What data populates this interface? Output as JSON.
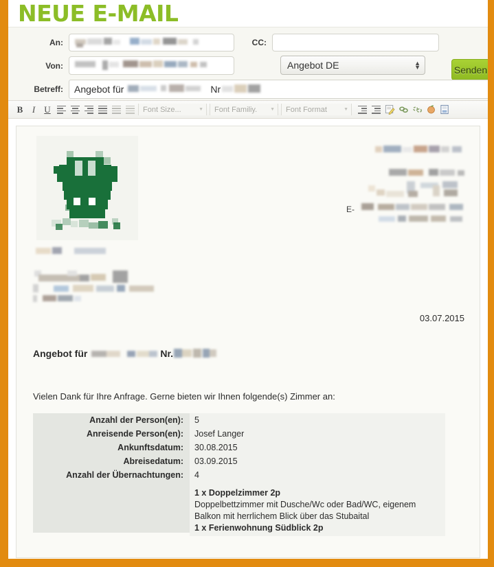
{
  "window": {
    "title": "NEUE E-MAIL",
    "title_color": "#8cbd27",
    "frame_color": "#e28b10"
  },
  "form": {
    "to_label": "An:",
    "to_value": "",
    "from_label": "Von:",
    "from_value": "",
    "cc_label": "CC:",
    "cc_value": "",
    "subject_label": "Betreff:",
    "subject_value": "Angebot für",
    "subject_value_tail": "Nr",
    "template_select": "Angebot DE",
    "send_label": "Senden"
  },
  "toolbar": {
    "bold": "B",
    "italic": "I",
    "underline": "U",
    "align_left": "align-left",
    "align_center": "align-center",
    "align_right": "align-right",
    "align_justify": "align-justify",
    "list_ordered": "ordered-list",
    "list_unordered": "unordered-list",
    "font_size": "Font Size...",
    "font_family": "Font Familiy.",
    "font_format": "Font Format",
    "indent": "indent",
    "outdent": "outdent",
    "spellcheck": "spellcheck",
    "link": "link",
    "unlink": "unlink",
    "anchor": "anchor",
    "source": "source"
  },
  "email": {
    "logo_alt": "cow-head-logo",
    "logo_color": "#19703a",
    "contact_prefix": "E-",
    "date": "03.07.2015",
    "offer_heading": "Angebot für",
    "offer_number_label": "Nr.",
    "intro": "Vielen Dank für Ihre Anfrage. Gerne bieten wir Ihnen folgende(s) Zimmer an:",
    "watermark": "",
    "details": [
      {
        "key": "Anzahl der Person(en):",
        "value": "5"
      },
      {
        "key": "Anreisende Person(en):",
        "value": "Josef Langer"
      },
      {
        "key": "Ankunftsdatum:",
        "value": "30.08.2015"
      },
      {
        "key": "Abreisedatum:",
        "value": "03.09.2015"
      },
      {
        "key": "Anzahl der Übernachtungen:",
        "value": "4"
      }
    ],
    "rooms": [
      {
        "title": "1 x Doppelzimmer 2p",
        "desc_line1": "Doppelbettzimmer mit Dusche/Wc oder Bad/WC, eigenem",
        "desc_line2": "Balkon mit herrlichem Blick über das Stubaital"
      },
      {
        "title": "1 x Ferienwohnung Südblick 2p",
        "desc_line1": "",
        "desc_line2": ""
      }
    ]
  }
}
